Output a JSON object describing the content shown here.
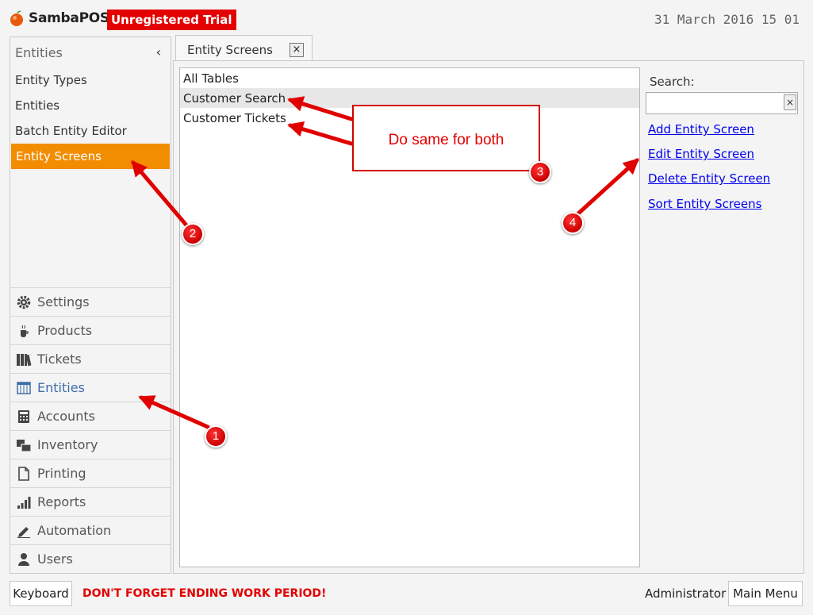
{
  "app": {
    "brand": "SambaPOS",
    "trial_badge": "Unregistered Trial",
    "clock": "31 March 2016 15 01"
  },
  "sidebar": {
    "header": "Entities",
    "collapse_glyph": "‹",
    "items": [
      {
        "label": "Entity Types"
      },
      {
        "label": "Entities"
      },
      {
        "label": "Batch Entity Editor"
      },
      {
        "label": "Entity Screens"
      }
    ],
    "active_color": "#f28c00"
  },
  "nav": [
    {
      "label": "Settings",
      "icon": "gear-icon"
    },
    {
      "label": "Products",
      "icon": "coffee-cup-icon"
    },
    {
      "label": "Tickets",
      "icon": "binders-icon"
    },
    {
      "label": "Entities",
      "icon": "table-grid-icon"
    },
    {
      "label": "Accounts",
      "icon": "calculator-icon"
    },
    {
      "label": "Inventory",
      "icon": "inventory-icon"
    },
    {
      "label": "Printing",
      "icon": "document-icon"
    },
    {
      "label": "Reports",
      "icon": "bar-chart-icon"
    },
    {
      "label": "Automation",
      "icon": "pencil-icon"
    },
    {
      "label": "Users",
      "icon": "user-icon"
    }
  ],
  "tab": {
    "label": "Entity Screens",
    "close_glyph": "×"
  },
  "list": {
    "rows": [
      "All Tables",
      "Customer Search",
      "Customer Tickets"
    ]
  },
  "search": {
    "label": "Search:",
    "value": "",
    "clear_glyph": "×"
  },
  "links": {
    "add": "Add Entity Screen",
    "edit": "Edit Entity Screen",
    "delete": "Delete Entity Screen",
    "sort": "Sort Entity Screens"
  },
  "footer": {
    "keyboard": "Keyboard",
    "warning": "DON'T FORGET ENDING WORK PERIOD!",
    "user": "Administrator",
    "main_menu": "Main Menu"
  },
  "annotations": {
    "callout": "Do same for both",
    "badges": [
      "1",
      "2",
      "3",
      "4"
    ],
    "accent": "#e30000"
  }
}
